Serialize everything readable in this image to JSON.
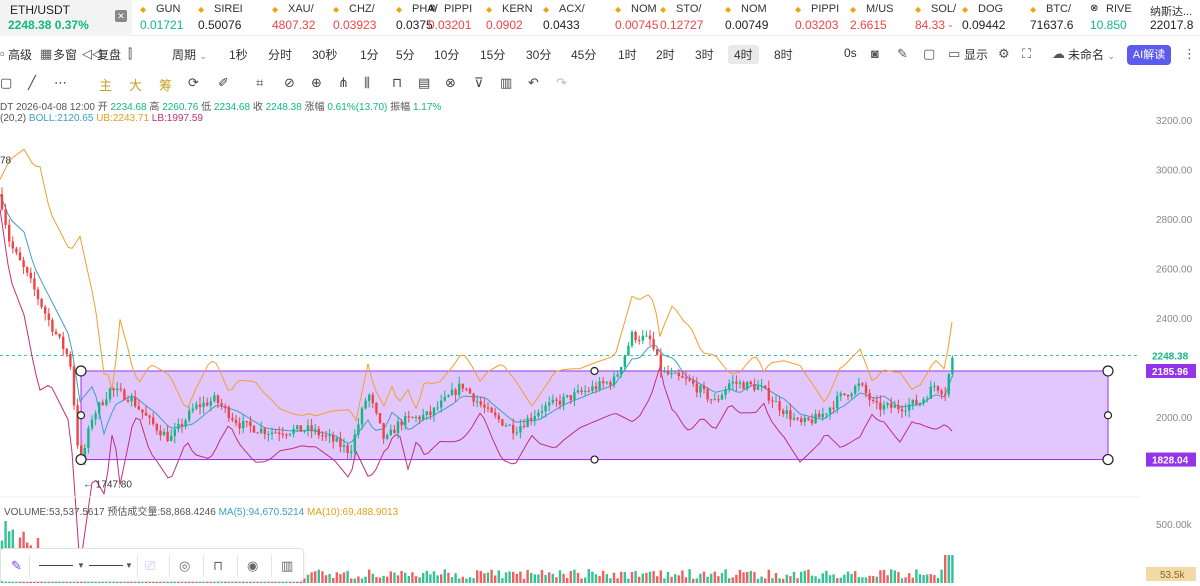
{
  "ticker": {
    "main_symbol": "ETH/USDT",
    "main_price": "2248.38",
    "main_change": "0.37%",
    "items": [
      {
        "name": "GUN",
        "value": "0.01721",
        "color": "#10b981",
        "icon": "diamond"
      },
      {
        "name": "SIREI",
        "value": "0.50076",
        "color": "#222222",
        "icon": "diamond"
      },
      {
        "name": "XAU/",
        "value": "4807.32",
        "color": "#ef4444",
        "icon": "diamond"
      },
      {
        "name": "CHZ/",
        "value": "0.03923",
        "color": "#ef4444",
        "icon": "diamond"
      },
      {
        "name": "PHA/",
        "value": "0.0375",
        "color": "#222222",
        "icon": "diamond"
      },
      {
        "name": "PIPPI",
        "value": "0.03201",
        "color": "#ef4444",
        "icon": "x"
      },
      {
        "name": "KERN",
        "value": "0.0902",
        "color": "#ef4444",
        "icon": "diamond"
      },
      {
        "name": "ACX/",
        "value": "0.0433",
        "color": "#222222",
        "icon": "diamond"
      },
      {
        "name": "NOM",
        "value": "0.00745",
        "color": "#ef4444",
        "icon": "diamond"
      },
      {
        "name": "STO/",
        "value": "0.12727",
        "color": "#ef4444",
        "icon": "diamond"
      },
      {
        "name": "NOM",
        "value": "0.00749",
        "color": "#222222",
        "icon": "diamond"
      },
      {
        "name": "PIPPI",
        "value": "0.03203",
        "color": "#ef4444",
        "icon": "diamond"
      },
      {
        "name": "M/US",
        "value": "2.6615",
        "color": "#ef4444",
        "icon": "diamond"
      },
      {
        "name": "SOL/",
        "value": "84.33 -",
        "color": "#ef4444",
        "icon": "diamond"
      },
      {
        "name": "DOG",
        "value": "0.09442",
        "color": "#222222",
        "icon": "diamond"
      },
      {
        "name": "BTC/",
        "value": "71637.6",
        "color": "#222222",
        "icon": "diamond"
      },
      {
        "name": "RIVE",
        "value": "10.850",
        "color": "#10b981",
        "icon": "x"
      },
      {
        "name": "纳斯达...",
        "value": "22017.8",
        "color": "#222222",
        "icon": "none"
      }
    ]
  },
  "toolbar": {
    "left_items": [
      "高级",
      "多窗",
      "复盘"
    ],
    "period_label": "周期",
    "intervals": [
      "1秒",
      "分时",
      "30秒",
      "1分",
      "5分",
      "10分",
      "15分",
      "30分",
      "45分",
      "1时",
      "2时",
      "3时",
      "4时",
      "8时"
    ],
    "active_interval": "4时",
    "zero_s": "0s",
    "display_label": "显示",
    "layout_name": "未命名",
    "ai_label": "AI解读"
  },
  "drawbar": {
    "gold_labels": [
      "主",
      "大",
      "筹"
    ]
  },
  "info": {
    "ohlc_prefix": "DT",
    "datetime": "2026-04-08 12:00",
    "open_label": "开",
    "open": "2234.68",
    "high_label": "高",
    "high": "2260.76",
    "low_label": "低",
    "low": "2234.68",
    "close_label": "收",
    "close": "2248.38",
    "change_label": "涨幅",
    "change": "0.61%(13.70)",
    "amplitude_label": "振幅",
    "amplitude": "1.17%",
    "boll_params": "(20,2)",
    "boll": "BOLL:2120.65",
    "ub": "UB:2243.71",
    "lb": "LB:1997.59",
    "volume": "VOLUME:53,537.5617",
    "est_volume": "预估成交量:58,868.4246",
    "ma5": "MA(5):94,670.5214",
    "ma10": "MA(10):69,488.9013"
  },
  "axis": {
    "price_ticks": [
      "3200.00",
      "3000.00",
      "2800.00",
      "2600.00",
      "2400.00",
      "2000.00"
    ],
    "price_tick_values": [
      3200,
      3000,
      2800,
      2600,
      2400,
      2000
    ],
    "current_price_label": "2248.38",
    "current_price": 2248.38,
    "rect_top_label": "2185.96",
    "rect_top_value": 2185.96,
    "rect_bottom_label": "1828.04",
    "rect_bottom_value": 1828.04,
    "low_marker": "← 1747.80",
    "low_marker_value": 1747.8,
    "left_clip_label": "78",
    "left_clip_value": 3040,
    "vol_tick": "500.00k",
    "vol_current": "53.5k"
  },
  "colors": {
    "up": "#10b981",
    "down": "#ef4444",
    "rect_fill": "#d8b4fe",
    "rect_stroke": "#9333ea",
    "boll_mid": "#3aa0c8",
    "boll_ub": "#f0a030",
    "boll_lb": "#c0307a",
    "accent": "#5b5bf0"
  }
}
